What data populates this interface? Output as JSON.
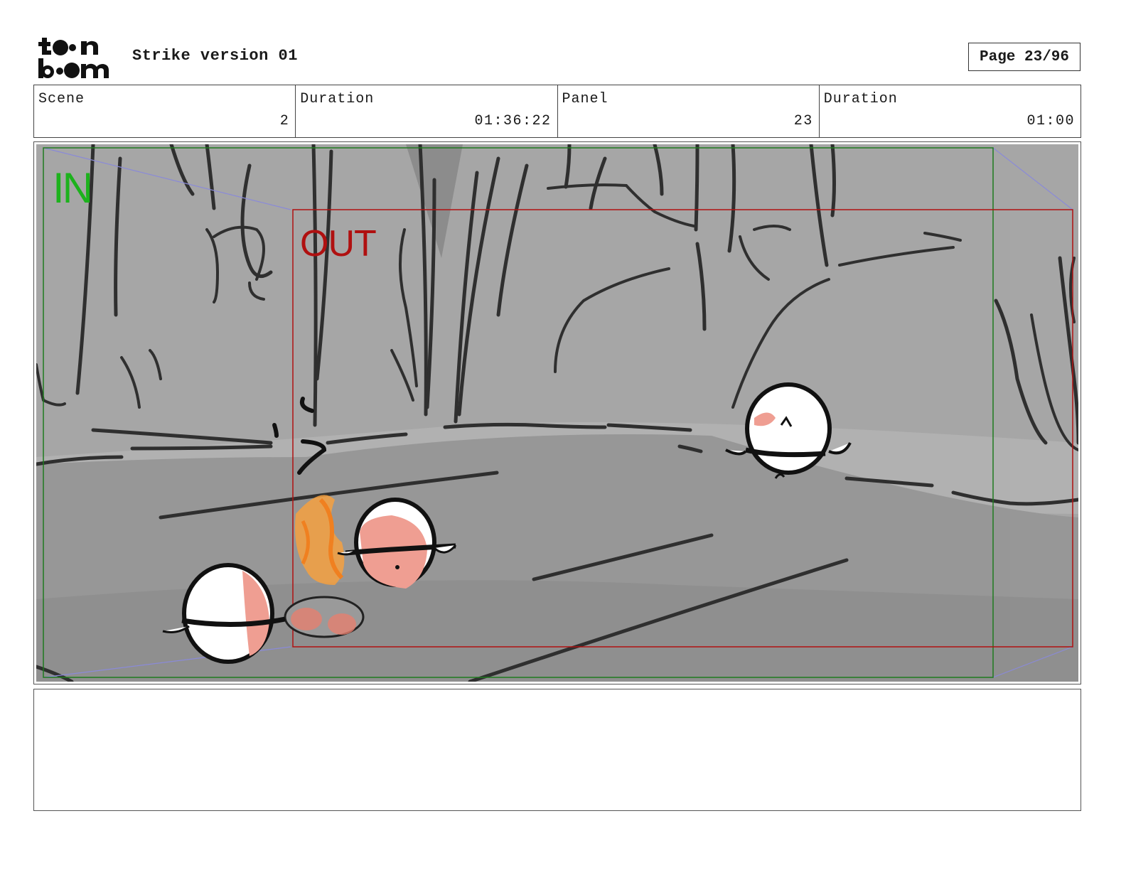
{
  "header": {
    "logo": {
      "icon": "toonboom-logo",
      "line1": "toon",
      "line2": "boom"
    },
    "title": "Strike version 01",
    "page_label": "Page 23/96"
  },
  "info": {
    "scene_label": "Scene",
    "scene_value": "2",
    "scene_duration_label": "Duration",
    "scene_duration_value": "01:36:22",
    "panel_label": "Panel",
    "panel_value": "23",
    "panel_duration_label": "Duration",
    "panel_duration_value": "01:00"
  },
  "panel": {
    "in_label": "IN",
    "out_label": "OUT",
    "colors": {
      "in_frame": "#1f7a1f",
      "out_frame": "#b01010",
      "camera_path": "#8a8ad8"
    }
  },
  "notes": {
    "text": ""
  }
}
